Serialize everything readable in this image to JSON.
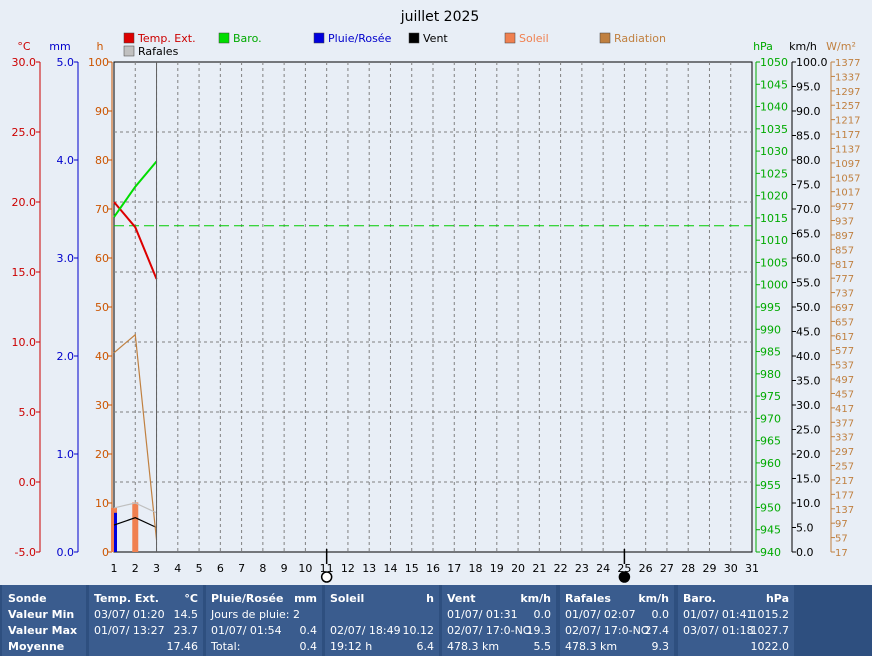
{
  "chart_data": {
    "type": "line",
    "title": "juillet 2025",
    "x": [
      1,
      2,
      3
    ],
    "x_ticks": [
      "1",
      "2",
      "3",
      "4",
      "5",
      "6",
      "7",
      "8",
      "9",
      "10",
      "11",
      "12",
      "13",
      "14",
      "15",
      "16",
      "17",
      "18",
      "19",
      "20",
      "21",
      "22",
      "23",
      "24",
      "25",
      "26",
      "27",
      "28",
      "29",
      "30",
      "31"
    ],
    "xlim": [
      1,
      31
    ],
    "axes": {
      "temp": {
        "unit": "°C",
        "ticks": [
          "30.0",
          "25.0",
          "20.0",
          "15.0",
          "10.0",
          "5.0",
          "0.0",
          "-5.0"
        ],
        "range": [
          -5,
          30
        ],
        "color": "#cc0000"
      },
      "rain": {
        "unit": "mm",
        "ticks": [
          "5.0",
          "4.0",
          "3.0",
          "2.0",
          "1.0",
          "0.0"
        ],
        "range": [
          0,
          5
        ],
        "color": "#0000cc"
      },
      "sun": {
        "unit": "h",
        "ticks": [
          "100",
          "90",
          "80",
          "70",
          "60",
          "50",
          "40",
          "30",
          "20",
          "10",
          "0"
        ],
        "range": [
          0,
          100
        ],
        "color": "#cc5500"
      },
      "baro": {
        "unit": "hPa",
        "ticks": [
          "1050",
          "1045",
          "1040",
          "1035",
          "1030",
          "1025",
          "1020",
          "1015",
          "1010",
          "1005",
          "1000",
          "995",
          "990",
          "985",
          "980",
          "975",
          "970",
          "965",
          "960",
          "955",
          "950",
          "945",
          "940"
        ],
        "range": [
          940,
          1050
        ],
        "color": "#00aa00"
      },
      "wind": {
        "unit": "km/h",
        "ticks": [
          "100.0",
          "95.0",
          "90.0",
          "85.0",
          "80.0",
          "75.0",
          "70.0",
          "65.0",
          "60.0",
          "55.0",
          "50.0",
          "45.0",
          "40.0",
          "35.0",
          "30.0",
          "25.0",
          "20.0",
          "15.0",
          "10.0",
          "5.0",
          "0.0"
        ],
        "range": [
          0,
          100
        ],
        "color": "#000000"
      },
      "rad": {
        "unit": "W/m²",
        "ticks": [
          "1377",
          "1337",
          "1297",
          "1257",
          "1217",
          "1177",
          "1137",
          "1097",
          "1057",
          "1017",
          "977",
          "937",
          "897",
          "857",
          "817",
          "777",
          "737",
          "697",
          "657",
          "617",
          "577",
          "537",
          "497",
          "457",
          "417",
          "377",
          "337",
          "297",
          "257",
          "217",
          "177",
          "137",
          "97",
          "57",
          "17"
        ],
        "range": [
          17,
          1377
        ],
        "color": "#c08040"
      }
    },
    "legend": [
      {
        "label": "Temp. Ext.",
        "color": "#dd0000"
      },
      {
        "label": "Baro.",
        "color": "#00dd00"
      },
      {
        "label": "Pluie/Rosée",
        "color": "#0000dd"
      },
      {
        "label": "Vent",
        "color": "#000000"
      },
      {
        "label": "Soleil",
        "color": "#f08050"
      },
      {
        "label": "Radiation",
        "color": "#c08040"
      },
      {
        "label": "Rafales",
        "color": "#c0c0c0"
      }
    ],
    "series": [
      {
        "name": "Temp. Ext.",
        "axis": "temp",
        "color": "#dd0000",
        "values": [
          20.0,
          18.2,
          14.5
        ]
      },
      {
        "name": "Baro.",
        "axis": "baro",
        "color": "#00dd00",
        "values": [
          1015.2,
          1022.0,
          1027.7
        ]
      },
      {
        "name": "Vent",
        "axis": "wind",
        "color": "#000000",
        "values": [
          5.5,
          7.0,
          5.0
        ]
      },
      {
        "name": "Radiation",
        "axis": "rad",
        "color": "#c08040",
        "values": [
          570,
          620,
          50
        ]
      },
      {
        "name": "Rafales",
        "axis": "wind",
        "color": "#c0c0c0",
        "values": [
          9.0,
          10.0,
          8.0
        ]
      }
    ],
    "bars": {
      "name": "Soleil",
      "axis": "sun",
      "color": "#f08050",
      "values": [
        9.0,
        10.12,
        0
      ]
    },
    "rain_bars": {
      "name": "Pluie/Rosée",
      "axis": "rain",
      "color": "#0000dd",
      "values": [
        0.4,
        0,
        0
      ]
    },
    "baro_reference": 1013.25,
    "moon": [
      {
        "day": 11,
        "phase": "full"
      },
      {
        "day": 25,
        "phase": "new"
      }
    ]
  },
  "table": {
    "rows": [
      "Sonde",
      "Valeur Min",
      "Valeur Max",
      "Moyenne"
    ],
    "temp": {
      "title": "Temp. Ext.",
      "unit": "°C",
      "min_time": "03/07/  01:20",
      "min": "14.5",
      "max_time": "01/07/  13:27",
      "max": "23.7",
      "avg": "17.46"
    },
    "rain": {
      "title": "Pluie/Rosée",
      "unit": "mm",
      "days": "Jours de pluie: 2",
      "max_time": "01/07/  01:54",
      "max": "0.4",
      "total_label": "Total:",
      "total": "0.4"
    },
    "sun": {
      "title": "Soleil",
      "unit": "h",
      "max_time": "02/07/  18:49",
      "max": "10.12",
      "total_time": "19:12 h",
      "total": "6.4"
    },
    "wind": {
      "title": "Vent",
      "unit": "km/h",
      "min_time": "01/07/  01:31",
      "min": "0.0",
      "max_time": "02/07/  17:0-NO",
      "max": "19.3",
      "dist": "478.3 km",
      "avg": "5.5"
    },
    "gust": {
      "title": "Rafales",
      "unit": "km/h",
      "min_time": "01/07/  02:07",
      "min": "0.0",
      "max_time": "02/07/  17:0-NO",
      "max": "27.4",
      "dist": "478.3 km",
      "avg": "9.3"
    },
    "baro": {
      "title": "Baro.",
      "unit": "hPa",
      "min_time": "01/07/  01:41",
      "min": "1015.2",
      "max_time": "03/07/  01:18",
      "max": "1027.7",
      "avg": "1022.0"
    }
  }
}
